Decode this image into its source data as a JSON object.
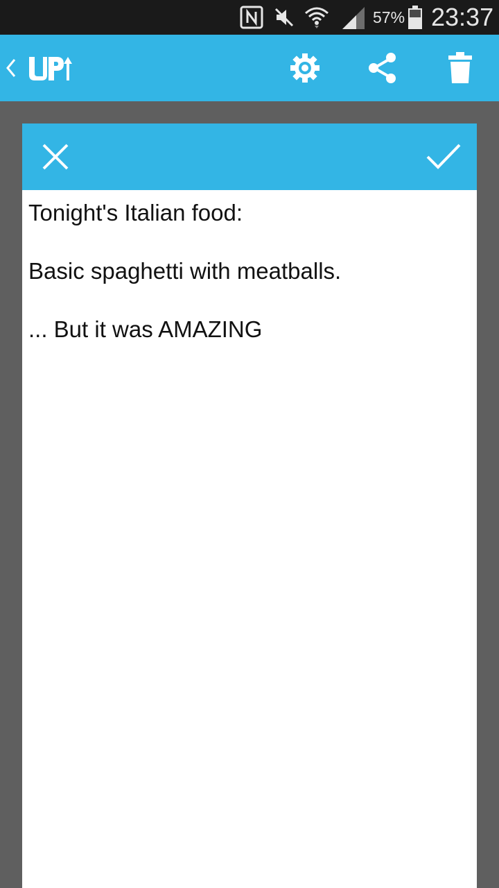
{
  "status_bar": {
    "icons": [
      "nfc-icon",
      "mute-icon",
      "wifi-icon",
      "signal-icon",
      "battery-icon"
    ],
    "battery_percent": "57%",
    "time": "23:37"
  },
  "app_bar": {
    "logo_text": "UP",
    "actions": [
      "settings-icon",
      "share-icon",
      "trash-icon"
    ],
    "accent_color": "#33b5e5"
  },
  "dialog": {
    "cancel_icon": "close-icon",
    "confirm_icon": "check-icon",
    "note_lines": [
      "Tonight's Italian food:",
      "Basic spaghetti with meatballs.",
      "... But it was AMAZING"
    ]
  }
}
